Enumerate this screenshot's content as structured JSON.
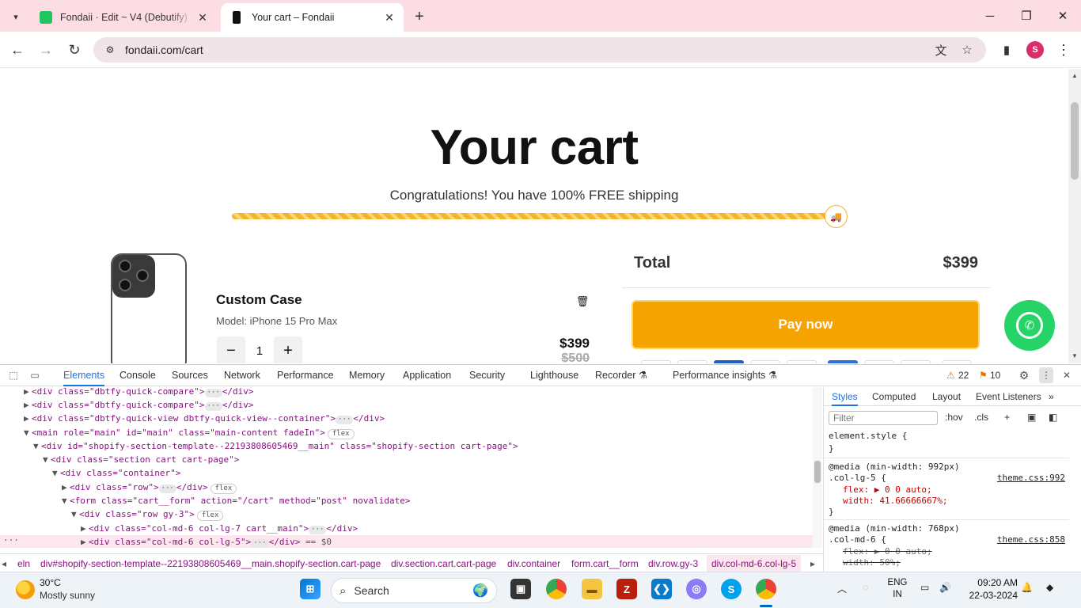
{
  "browser": {
    "tabs": [
      {
        "title": "Fondaii · Edit ~ V4 (Debutify) · S",
        "active": false
      },
      {
        "title": "Your cart – Fondaii",
        "active": true
      }
    ],
    "url": "fondaii.com/cart",
    "profile_initial": "S"
  },
  "cart": {
    "title": "Your cart",
    "shipping_message": "Congratulations! You have 100% FREE shipping",
    "shipping_progress_percent": 100,
    "item": {
      "name": "Custom Case",
      "model": "Model: iPhone 15 Pro Max",
      "quantity": "1",
      "price": "$399",
      "compare_price": "$500"
    },
    "total_label": "Total",
    "total_value": "$399",
    "pay_button": "Pay now"
  },
  "devtools": {
    "tabs": [
      "Elements",
      "Console",
      "Sources",
      "Network",
      "Performance",
      "Memory",
      "Application",
      "Security",
      "Lighthouse",
      "Recorder ⚗",
      "Performance insights ⚗"
    ],
    "active_tab": "Elements",
    "warnings": "22",
    "issues": "10",
    "dom_lines": [
      {
        "indent": 0,
        "tri": "▶",
        "html": "<div class=\"dbtfy-quick-compare\">"
      },
      {
        "indent": 0,
        "tri": "▶",
        "html": "<div class=\"dbtfy-quick-compare\">"
      },
      {
        "indent": 0,
        "tri": "▶",
        "html": "<div class=\"dbtfy-quick-view dbtfy-quick-view--container\">"
      },
      {
        "indent": 0,
        "tri": "▼",
        "html": "<main role=\"main\" id=\"main\" class=\"main-content fadeIn\">"
      },
      {
        "indent": 1,
        "tri": "▼",
        "html": "<div id=\"shopify-section-template--22193808605469__main\" class=\"shopify-section cart-page\">"
      },
      {
        "indent": 2,
        "tri": "▼",
        "html": "<div class=\"section cart cart-page\">"
      },
      {
        "indent": 3,
        "tri": "▼",
        "html": "<div class=\"container\">"
      },
      {
        "indent": 4,
        "tri": "▶",
        "html": "<div class=\"row\">"
      },
      {
        "indent": 4,
        "tri": "▼",
        "html": "<form class=\"cart__form\" action=\"/cart\" method=\"post\" novalidate>"
      },
      {
        "indent": 5,
        "tri": "▼",
        "html": "<div class=\"row gy-3\">"
      },
      {
        "indent": 6,
        "tri": "▶",
        "html": "<div class=\"col-md-6 col-lg-7 cart__main\">"
      },
      {
        "indent": 6,
        "tri": "▶",
        "html": "<div class=\"col-md-6 col-lg-5\">"
      }
    ],
    "dom_suffix": "== $0",
    "styles_tabs": [
      "Styles",
      "Computed",
      "Layout",
      "Event Listeners"
    ],
    "filter_placeholder": "Filter",
    "hov": ":hov",
    "cls": ".cls",
    "rules": {
      "element_style": "element.style {",
      "close": "}",
      "media1": "@media (min-width: 992px)",
      "sel1": ".col-lg-5 {",
      "src1": "theme.css:992",
      "flex1": "flex: ▶ 0 0 auto;",
      "width1": "width: 41.66666667%;",
      "media2": "@media (min-width: 768px)",
      "sel2": ".col-md-6 {",
      "src2": "theme.css:858",
      "flex2": "flex: ▶ 0 0 auto;",
      "width2": "width: 50%;"
    },
    "breadcrumb": [
      "eln",
      "div#shopify-section-template--22193808605469__main.shopify-section.cart-page",
      "div.section.cart.cart-page",
      "div.container",
      "form.cart__form",
      "div.row.gy-3",
      "div.col-md-6.col-lg-5"
    ]
  },
  "taskbar": {
    "temperature": "30°C",
    "weather": "Mostly sunny",
    "search_label": "Search",
    "lang_line1": "ENG",
    "lang_line2": "IN",
    "time": "09:20 AM",
    "date": "22-03-2024"
  }
}
